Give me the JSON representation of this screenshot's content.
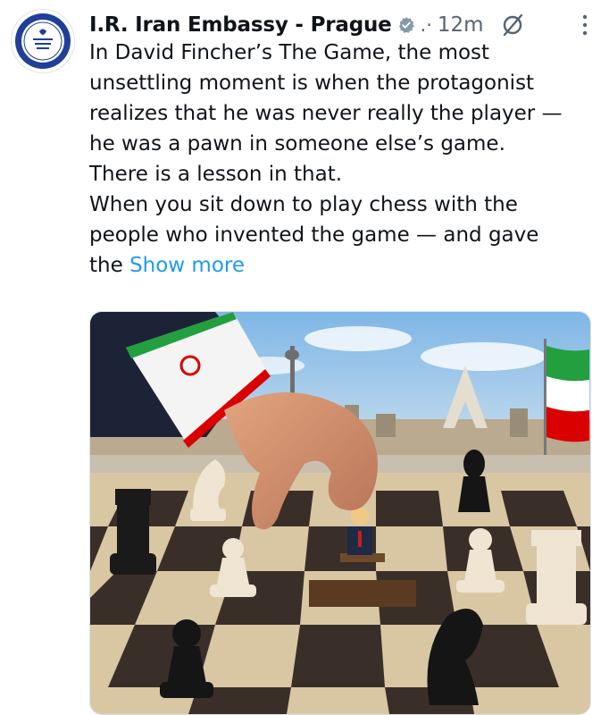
{
  "post": {
    "author_name": "I.R. Iran Embassy - Prague",
    "separator": ".·",
    "time": "12m",
    "lines": [
      "In David Fincher’s The Game, the most",
      "unsettling moment is when the protagonist",
      "realizes that he was never really the player —",
      "he was a pawn in someone else’s game.",
      "There is a lesson in that.",
      "When you sit down to play chess with the",
      "people who invented the game — and gave"
    ],
    "last_line_prefix": "the ",
    "show_more": "Show more"
  },
  "icons": {
    "verified": "verified-badge-icon",
    "grok": "grok-icon",
    "more": "more-options-icon"
  },
  "colors": {
    "text": "#0f1419",
    "secondary": "#536471",
    "link": "#1d9bf0",
    "verified": "#829aab"
  }
}
